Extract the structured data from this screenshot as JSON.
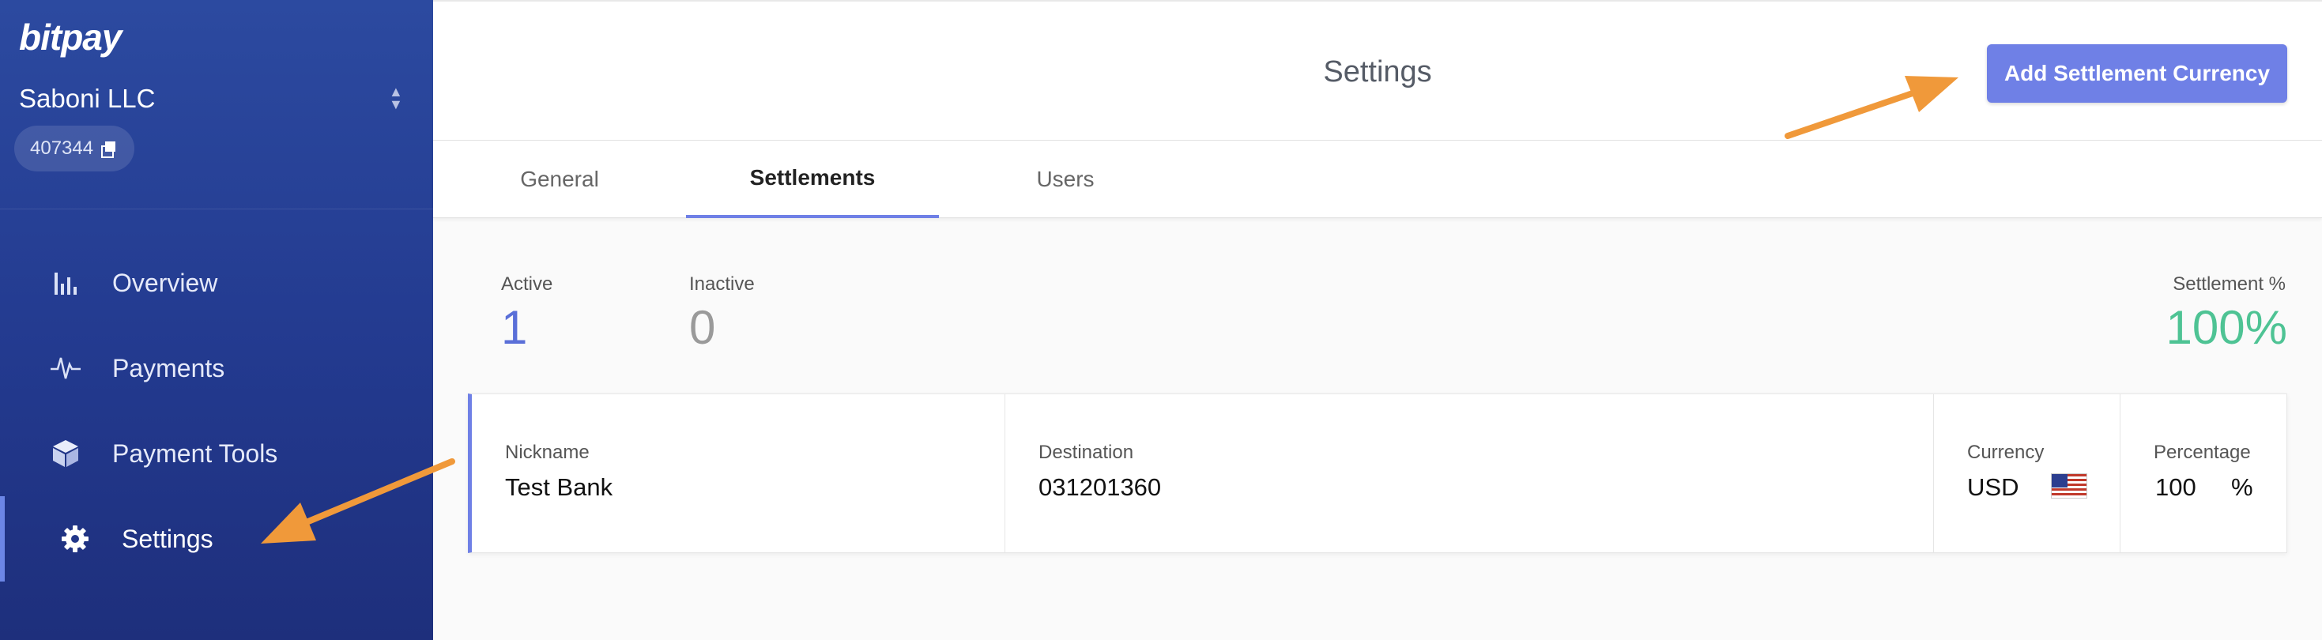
{
  "sidebar": {
    "logo": "bitpay",
    "org_name": "Saboni LLC",
    "org_id": "407344",
    "items": [
      {
        "label": "Overview",
        "icon": "bar-chart-icon"
      },
      {
        "label": "Payments",
        "icon": "pulse-icon"
      },
      {
        "label": "Payment Tools",
        "icon": "cube-icon"
      },
      {
        "label": "Settings",
        "icon": "gear-icon",
        "active": true
      }
    ]
  },
  "header": {
    "title": "Settings",
    "add_button": "Add Settlement Currency"
  },
  "tabs": [
    {
      "label": "General"
    },
    {
      "label": "Settlements",
      "active": true
    },
    {
      "label": "Users"
    }
  ],
  "stats": {
    "active_label": "Active",
    "active_value": "1",
    "inactive_label": "Inactive",
    "inactive_value": "0",
    "settlement_label": "Settlement %",
    "settlement_value": "100%"
  },
  "settlement": {
    "nickname_label": "Nickname",
    "nickname": "Test Bank",
    "destination_label": "Destination",
    "destination": "031201360",
    "currency_label": "Currency",
    "currency": "USD",
    "currency_flag": "us-flag-icon",
    "percentage_label": "Percentage",
    "percentage": "100",
    "percentage_unit": "%"
  },
  "colors": {
    "sidebar": "#233a8f",
    "accent": "#6f80e6",
    "success": "#4ec394",
    "annotation_arrow": "#f0993a"
  }
}
